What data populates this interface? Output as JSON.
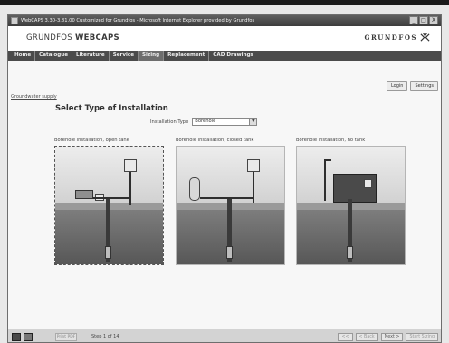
{
  "window": {
    "title": "WebCAPS 3.30-3.81.00 Customized for Grundfos - Microsoft Internet Explorer provided by Grundfos",
    "buttons": {
      "minimize": "_",
      "restore": "□",
      "close": "X"
    }
  },
  "brand": {
    "name_light": "GRUNDFOS ",
    "name_bold": "WEBCAPS",
    "logo_text": "GRUNDFOS"
  },
  "nav": {
    "items": [
      "Home",
      "Catalogue",
      "Literature",
      "Service",
      "Sizing",
      "Replacement",
      "CAD Drawings"
    ],
    "active": "Sizing"
  },
  "header_buttons": {
    "login": "Login",
    "settings": "Settings"
  },
  "breadcrumb": "Groundwater supply",
  "page": {
    "title": "Select Type of Installation",
    "type_label": "Installation Type",
    "type_value": "Borehole"
  },
  "options": [
    {
      "caption": "Borehole installation, open tank",
      "selected": true
    },
    {
      "caption": "Borehole installation, closed tank",
      "selected": false
    },
    {
      "caption": "Borehole installation, no tank",
      "selected": false
    }
  ],
  "status": {
    "print_label": "Print PDF",
    "step_text": "Step 1 of 14",
    "buttons": {
      "first": "<<",
      "back": "< Back",
      "next": "Next >",
      "start": "Start Sizing"
    }
  }
}
